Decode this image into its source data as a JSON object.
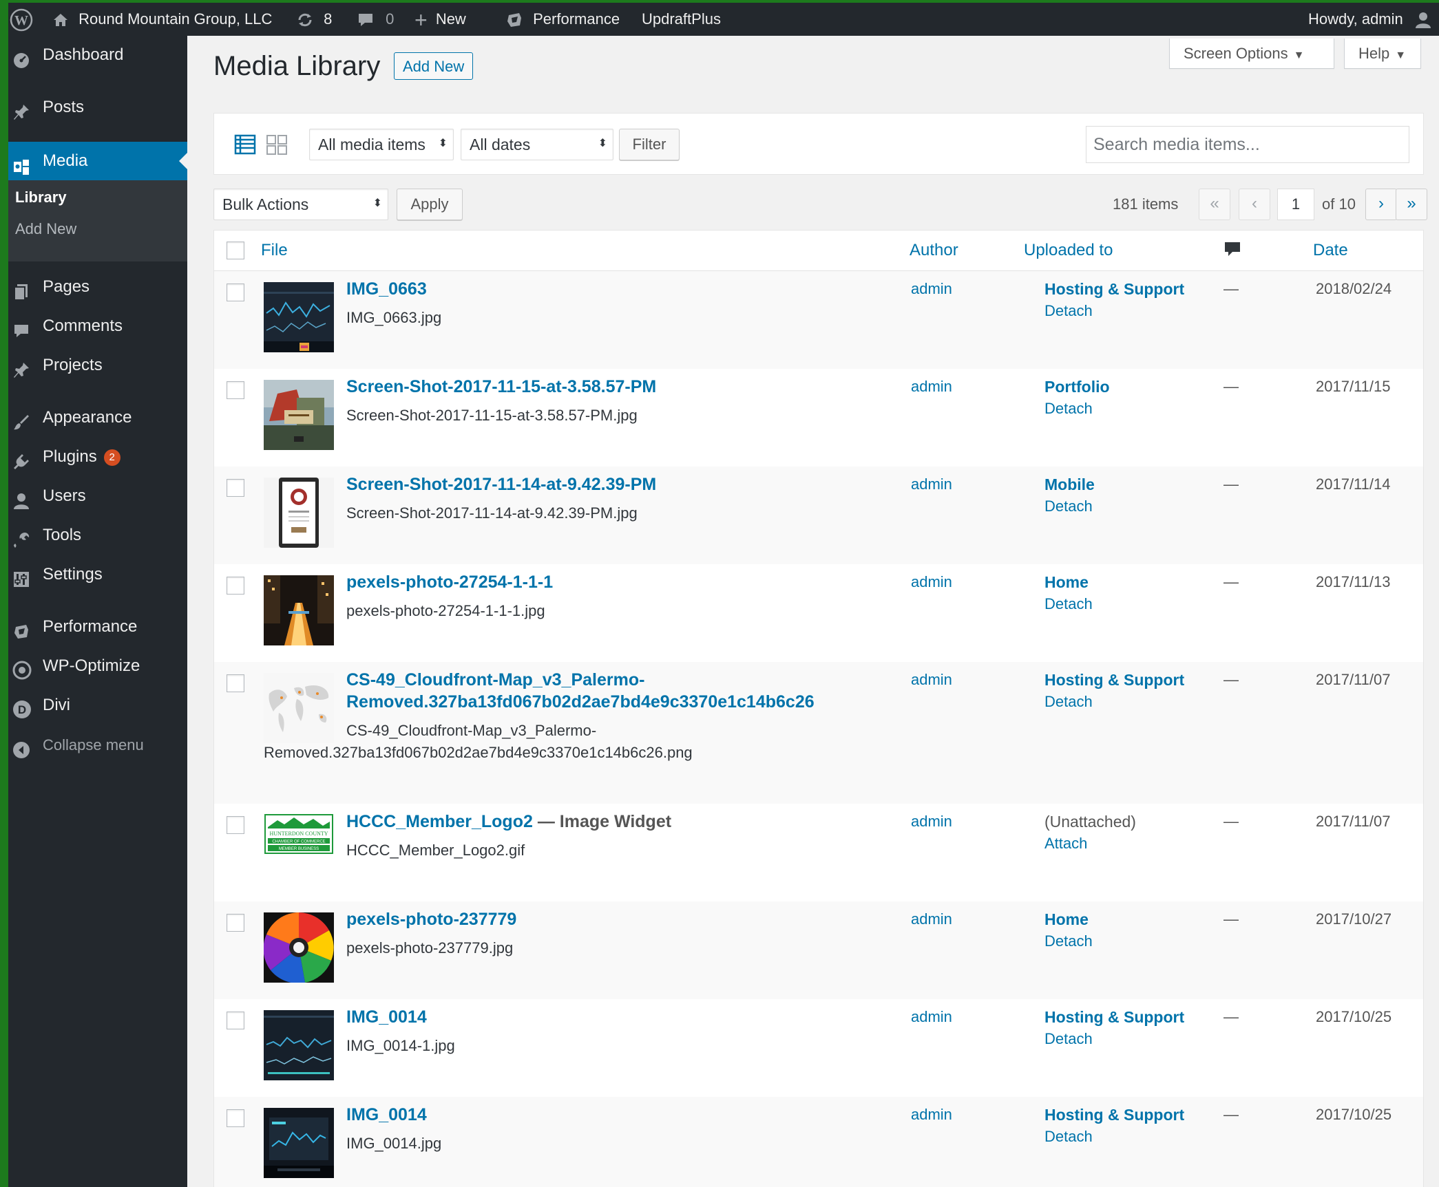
{
  "adminbar": {
    "site_name": "Round Mountain Group, LLC",
    "updates_count": "8",
    "comments_count": "0",
    "new_label": "New",
    "performance_label": "Performance",
    "updraft_label": "UpdraftPlus",
    "howdy": "Howdy, admin"
  },
  "sidebar": {
    "dashboard": "Dashboard",
    "posts": "Posts",
    "media": "Media",
    "library": "Library",
    "add_new": "Add New",
    "pages": "Pages",
    "comments": "Comments",
    "projects": "Projects",
    "appearance": "Appearance",
    "plugins": "Plugins",
    "plugins_badge": "2",
    "users": "Users",
    "tools": "Tools",
    "settings": "Settings",
    "performance": "Performance",
    "wp_optimize": "WP-Optimize",
    "divi": "Divi",
    "collapse": "Collapse menu"
  },
  "header": {
    "screen_options": "Screen Options",
    "help": "Help",
    "title": "Media Library",
    "add_new": "Add New"
  },
  "filters": {
    "media_type": "All media items",
    "dates": "All dates",
    "filter_button": "Filter",
    "search_placeholder": "Search media items..."
  },
  "tablenav": {
    "bulk_actions": "Bulk Actions",
    "apply": "Apply",
    "items_count": "181 items",
    "first": "«",
    "prev": "‹",
    "current_page": "1",
    "of_pages": "of 10",
    "next": "›",
    "last": "»"
  },
  "columns": {
    "file": "File",
    "author": "Author",
    "uploaded_to": "Uploaded to",
    "date": "Date"
  },
  "rows": [
    {
      "title": "IMG_0663",
      "suffix": "",
      "filename": "IMG_0663.jpg",
      "author": "admin",
      "uploaded": "Hosting & Support",
      "action": "Detach",
      "dash": "—",
      "date": "2018/02/24",
      "thumb": "dashboard-dark"
    },
    {
      "title": "Screen-Shot-2017-11-15-at-3.58.57-PM",
      "suffix": "",
      "filename": "Screen-Shot-2017-11-15-at-3.58.57-PM.jpg",
      "author": "admin",
      "uploaded": "Portfolio",
      "action": "Detach",
      "dash": "—",
      "date": "2017/11/15",
      "thumb": "red-barn-photo"
    },
    {
      "title": "Screen-Shot-2017-11-14-at-9.42.39-PM",
      "suffix": "",
      "filename": "Screen-Shot-2017-11-14-at-9.42.39-PM.jpg",
      "author": "admin",
      "uploaded": "Mobile",
      "action": "Detach",
      "dash": "—",
      "date": "2017/11/14",
      "thumb": "mobile-phone"
    },
    {
      "title": "pexels-photo-27254-1-1-1",
      "suffix": "",
      "filename": "pexels-photo-27254-1-1-1.jpg",
      "author": "admin",
      "uploaded": "Home",
      "action": "Detach",
      "dash": "—",
      "date": "2017/11/13",
      "thumb": "night-city"
    },
    {
      "title_line1": "CS-49_Cloudfront-Map_v3_Palermo-",
      "title_line2": "Removed.327ba13fd067b02d2ae7bd4e9c3370e1c14b6c26",
      "filename_line1": "CS-49_Cloudfront-Map_v3_Palermo-",
      "filename_line2": "Removed.327ba13fd067b02d2ae7bd4e9c3370e1c14b6c26.png",
      "author": "admin",
      "uploaded": "Hosting & Support",
      "action": "Detach",
      "dash": "—",
      "date": "2017/11/07",
      "thumb": "world-map"
    },
    {
      "title": "HCCC_Member_Logo2",
      "suffix": " — Image Widget",
      "filename": "HCCC_Member_Logo2.gif",
      "author": "admin",
      "uploaded": "(Unattached)",
      "action": "Attach",
      "dash": "—",
      "date": "2017/11/07",
      "thumb": "green-logo"
    },
    {
      "title": "pexels-photo-237779",
      "suffix": "",
      "filename": "pexels-photo-237779.jpg",
      "author": "admin",
      "uploaded": "Home",
      "action": "Detach",
      "dash": "—",
      "date": "2017/10/27",
      "thumb": "balloon"
    },
    {
      "title": "IMG_0014",
      "suffix": "",
      "filename": "IMG_0014-1.jpg",
      "author": "admin",
      "uploaded": "Hosting & Support",
      "action": "Detach",
      "dash": "—",
      "date": "2017/10/25",
      "thumb": "dashboard-dark"
    },
    {
      "title": "IMG_0014",
      "suffix": "",
      "filename": "IMG_0014.jpg",
      "author": "admin",
      "uploaded": "Hosting & Support",
      "action": "Detach",
      "dash": "—",
      "date": "2017/10/25",
      "thumb": "dashboard-dark"
    }
  ],
  "colors": {
    "accent": "#0073aa",
    "adminbar": "#23282d",
    "badge": "#d54e21"
  }
}
